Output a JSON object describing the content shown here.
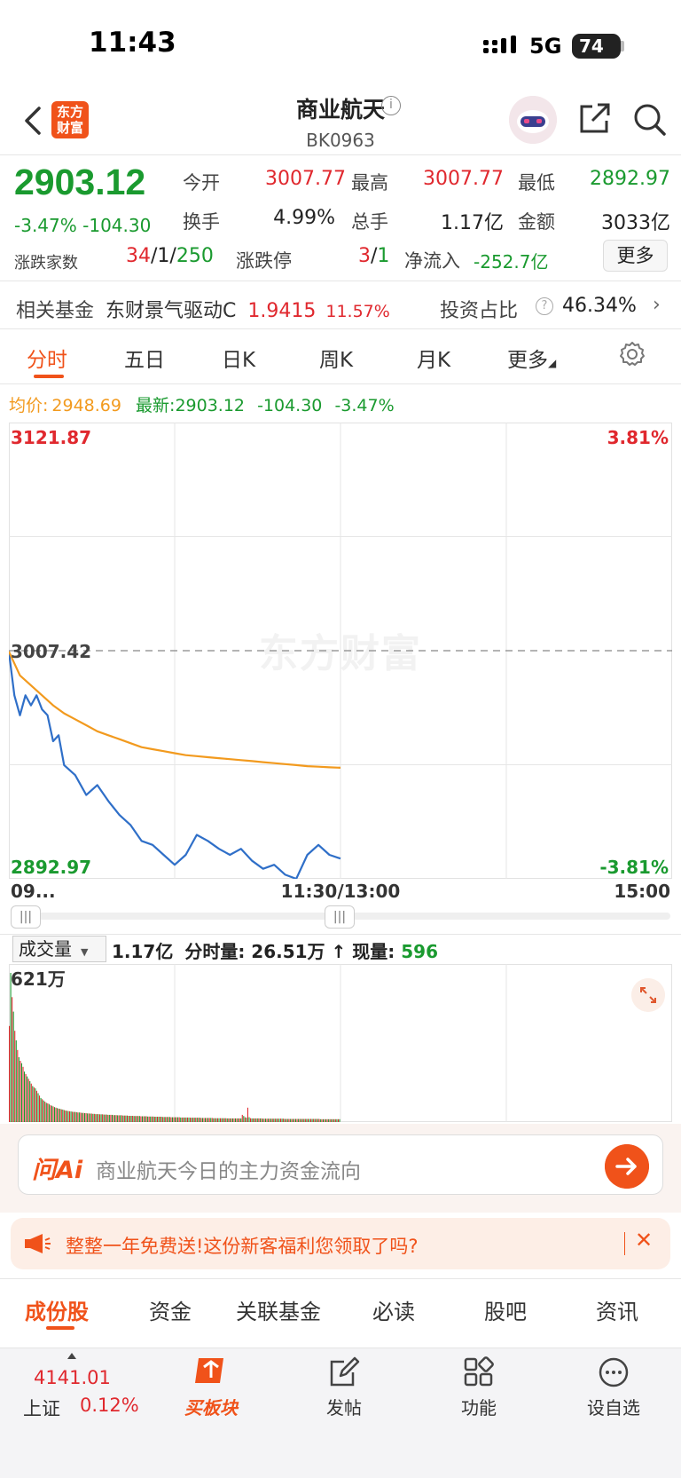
{
  "status_bar": {
    "time": "11:43",
    "network": "5G",
    "battery": "74"
  },
  "header": {
    "logo_text": "东方财富",
    "title": "商业航天",
    "info_glyph": "i",
    "code": "BK0963"
  },
  "quote": {
    "price": "2903.12",
    "change": "-3.47%",
    "change_abs": "-104.30",
    "open_label": "今开",
    "open_value": "3007.77",
    "high_label": "最高",
    "high_value": "3007.77",
    "low_label": "最低",
    "low_value": "2892.97",
    "turnover_label": "换手",
    "turnover_value": "4.99%",
    "volume_label": "总手",
    "volume_value": "1.17亿",
    "amount_label": "金额",
    "amount_value": "3033亿",
    "breadth_label": "涨跌家数",
    "breadth_up": "34",
    "breadth_flat": "1",
    "breadth_down": "250",
    "limit_label": "涨跌停",
    "limit_up": "3",
    "limit_down": "1",
    "netflow_label": "净流入",
    "netflow_value": "-252.7亿",
    "more_label": "更多"
  },
  "fund_row": {
    "label": "相关基金",
    "fund_name": "东财景气驱动C",
    "fund_value": "1.9415",
    "fund_change": "11.57%",
    "ratio_label": "投资占比",
    "ratio_value": "46.34%"
  },
  "chart_tabs": [
    "分时",
    "五日",
    "日K",
    "周K",
    "月K",
    "更多"
  ],
  "chart_legend": {
    "avg_label": "均价:",
    "avg_value": "2948.69",
    "latest_label": "最新:",
    "latest_value": "2903.12",
    "latest_change": "-104.30",
    "latest_pct": "-3.47%"
  },
  "watermark": "东方财富",
  "volume_section": {
    "selector_label": "成交量",
    "total": "1.17亿",
    "minute_label": "分时量:",
    "minute_value": "26.51万",
    "current_label": "现量:",
    "current_value": "596",
    "max_label": "621万"
  },
  "chart_data": [
    {
      "type": "line",
      "title": "",
      "x_tick_labels": [
        "09...",
        "11:30/13:00",
        "15:00"
      ],
      "y_tick_labels_left": [
        "3121.87",
        "3007.42",
        "2892.97"
      ],
      "y_tick_labels_right": [
        "3.81%",
        "-3.81%"
      ],
      "ylim": [
        2892.97,
        3121.87
      ],
      "reference_line": 3007.42,
      "reference_style": "dashed",
      "series": [
        {
          "name": "最新",
          "color": "#2f6fc8",
          "x": [
            0,
            2,
            4,
            6,
            8,
            10,
            12,
            14,
            16,
            18,
            20,
            24,
            28,
            32,
            36,
            40,
            44,
            48,
            52,
            56,
            60,
            64,
            68,
            72,
            76,
            80,
            84,
            88,
            92,
            96,
            100,
            104,
            108,
            112,
            116,
            120
          ],
          "y": [
            3007.0,
            2985.0,
            2975.0,
            2985.0,
            2980.0,
            2985.0,
            2978.0,
            2975.0,
            2962.0,
            2965.0,
            2950.0,
            2945.0,
            2935.0,
            2940.0,
            2932.0,
            2925.0,
            2920.0,
            2912.0,
            2910.0,
            2905.0,
            2900.0,
            2905.0,
            2915.0,
            2912.0,
            2908.0,
            2905.0,
            2908.0,
            2902.0,
            2898.0,
            2900.0,
            2895.0,
            2892.97,
            2905.0,
            2910.0,
            2905.0,
            2903.12
          ]
        },
        {
          "name": "均价",
          "color": "#f29a1e",
          "x": [
            0,
            4,
            8,
            12,
            16,
            20,
            24,
            28,
            32,
            36,
            40,
            44,
            48,
            52,
            56,
            60,
            64,
            68,
            72,
            76,
            80,
            84,
            88,
            92,
            96,
            100,
            104,
            108,
            112,
            116,
            120
          ],
          "y": [
            3007.0,
            2995.0,
            2990.0,
            2985.0,
            2980.0,
            2976.0,
            2973.0,
            2970.0,
            2967.0,
            2965.0,
            2963.0,
            2961.0,
            2959.0,
            2958.0,
            2957.0,
            2956.0,
            2955.0,
            2954.5,
            2954.0,
            2953.5,
            2953.0,
            2952.5,
            2952.0,
            2951.5,
            2951.0,
            2950.5,
            2950.0,
            2949.5,
            2949.2,
            2948.9,
            2948.69
          ]
        }
      ],
      "x_max": 240
    },
    {
      "type": "bar",
      "title": "成交量",
      "ylim": [
        0,
        621
      ],
      "unit": "万",
      "colors": {
        "up": "#e0282e",
        "down": "#1a9a2f"
      },
      "values": [
        400,
        621,
        520,
        460,
        380,
        340,
        300,
        270,
        255,
        245,
        230,
        210,
        200,
        190,
        180,
        170,
        160,
        150,
        145,
        140,
        130,
        120,
        110,
        100,
        95,
        90,
        85,
        80,
        78,
        75,
        70,
        68,
        65,
        62,
        60,
        58,
        56,
        55,
        53,
        52,
        50,
        48,
        47,
        46,
        45,
        44,
        43,
        42,
        42,
        41,
        40,
        40,
        39,
        38,
        38,
        37,
        37,
        36,
        36,
        35,
        35,
        34,
        34,
        33,
        33,
        33,
        32,
        32,
        32,
        31,
        31,
        31,
        30,
        30,
        30,
        30,
        29,
        29,
        29,
        28,
        28,
        28,
        28,
        27,
        27,
        27,
        27,
        26,
        26,
        26,
        26,
        25,
        25,
        25,
        25,
        25,
        24,
        24,
        24,
        24,
        24,
        23,
        23,
        23,
        23,
        23,
        22,
        22,
        22,
        22,
        22,
        22,
        21,
        21,
        21,
        21,
        21,
        21,
        20,
        20,
        20,
        20,
        20,
        20,
        20,
        19,
        19,
        19,
        19,
        19,
        19,
        19,
        18,
        18,
        18,
        18,
        18,
        18,
        18,
        18,
        17,
        17,
        17,
        17,
        17,
        17,
        17,
        17,
        17,
        16,
        16,
        16,
        16,
        16,
        16,
        16,
        16,
        16,
        16,
        15,
        15,
        15,
        15,
        15,
        15,
        15,
        15,
        15,
        15,
        15,
        30,
        25,
        20,
        18,
        60,
        20,
        16,
        15,
        15,
        15,
        15,
        15,
        15,
        15,
        15,
        14,
        14,
        14,
        14,
        14,
        14,
        14,
        14,
        14,
        14,
        14,
        14,
        14,
        14,
        14,
        14,
        13,
        13,
        13,
        13,
        13,
        13,
        13,
        13,
        13,
        13,
        13,
        13,
        13,
        13,
        13,
        13,
        13,
        13,
        13,
        13,
        13,
        13,
        13,
        13,
        13,
        13,
        12,
        12,
        12,
        12,
        12,
        12,
        12,
        12,
        12,
        12,
        12,
        12,
        12,
        12,
        12
      ]
    }
  ],
  "ai_bar": {
    "logo": "问Ai",
    "placeholder": "商业航天今日的主力资金流向"
  },
  "promo": {
    "text": "整整一年免费送!这份新客福利您领取了吗?",
    "close": "✕"
  },
  "bottom_tabs": [
    "成份股",
    "资金",
    "关联基金",
    "必读",
    "股吧",
    "资讯"
  ],
  "nav": {
    "index_value": "4141.01",
    "index_name": "上证",
    "index_change": "0.12%",
    "buy_label": "买板块",
    "post_label": "发帖",
    "func_label": "功能",
    "watch_label": "设自选"
  }
}
